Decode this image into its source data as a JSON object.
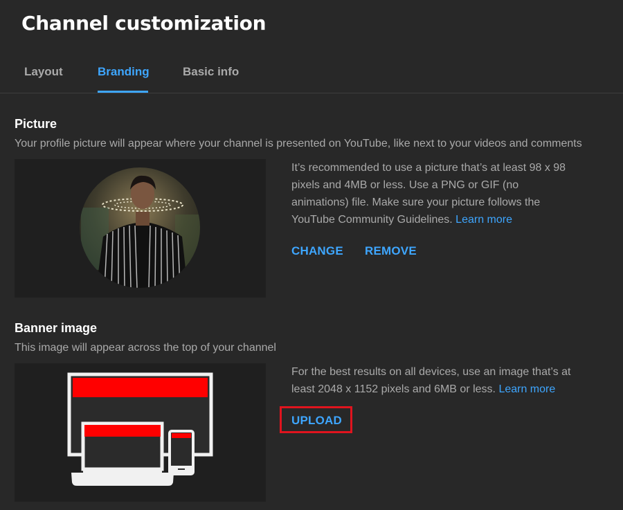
{
  "header": {
    "title": "Channel customization"
  },
  "tabs": [
    {
      "label": "Layout",
      "active": false
    },
    {
      "label": "Branding",
      "active": true
    },
    {
      "label": "Basic info",
      "active": false
    }
  ],
  "picture": {
    "title": "Picture",
    "description": "Your profile picture will appear where your channel is presented on YouTube, like next to your videos and comments",
    "info": "It’s recommended to use a picture that’s at least 98 x 98 pixels and 4MB or less. Use a PNG or GIF (no animations) file. Make sure your picture follows the YouTube Community Guidelines.",
    "learn_more": "Learn more",
    "change_label": "CHANGE",
    "remove_label": "REMOVE"
  },
  "banner": {
    "title": "Banner image",
    "description": "This image will appear across the top of your channel",
    "info": "For the best results on all devices, use an image that’s at least 2048 x 1152 pixels and 6MB or less.",
    "learn_more": "Learn more",
    "upload_label": "UPLOAD"
  },
  "colors": {
    "background": "#282828",
    "accent": "#3ea6ff",
    "highlight": "#e0141e",
    "banner_red": "#ff0000"
  }
}
